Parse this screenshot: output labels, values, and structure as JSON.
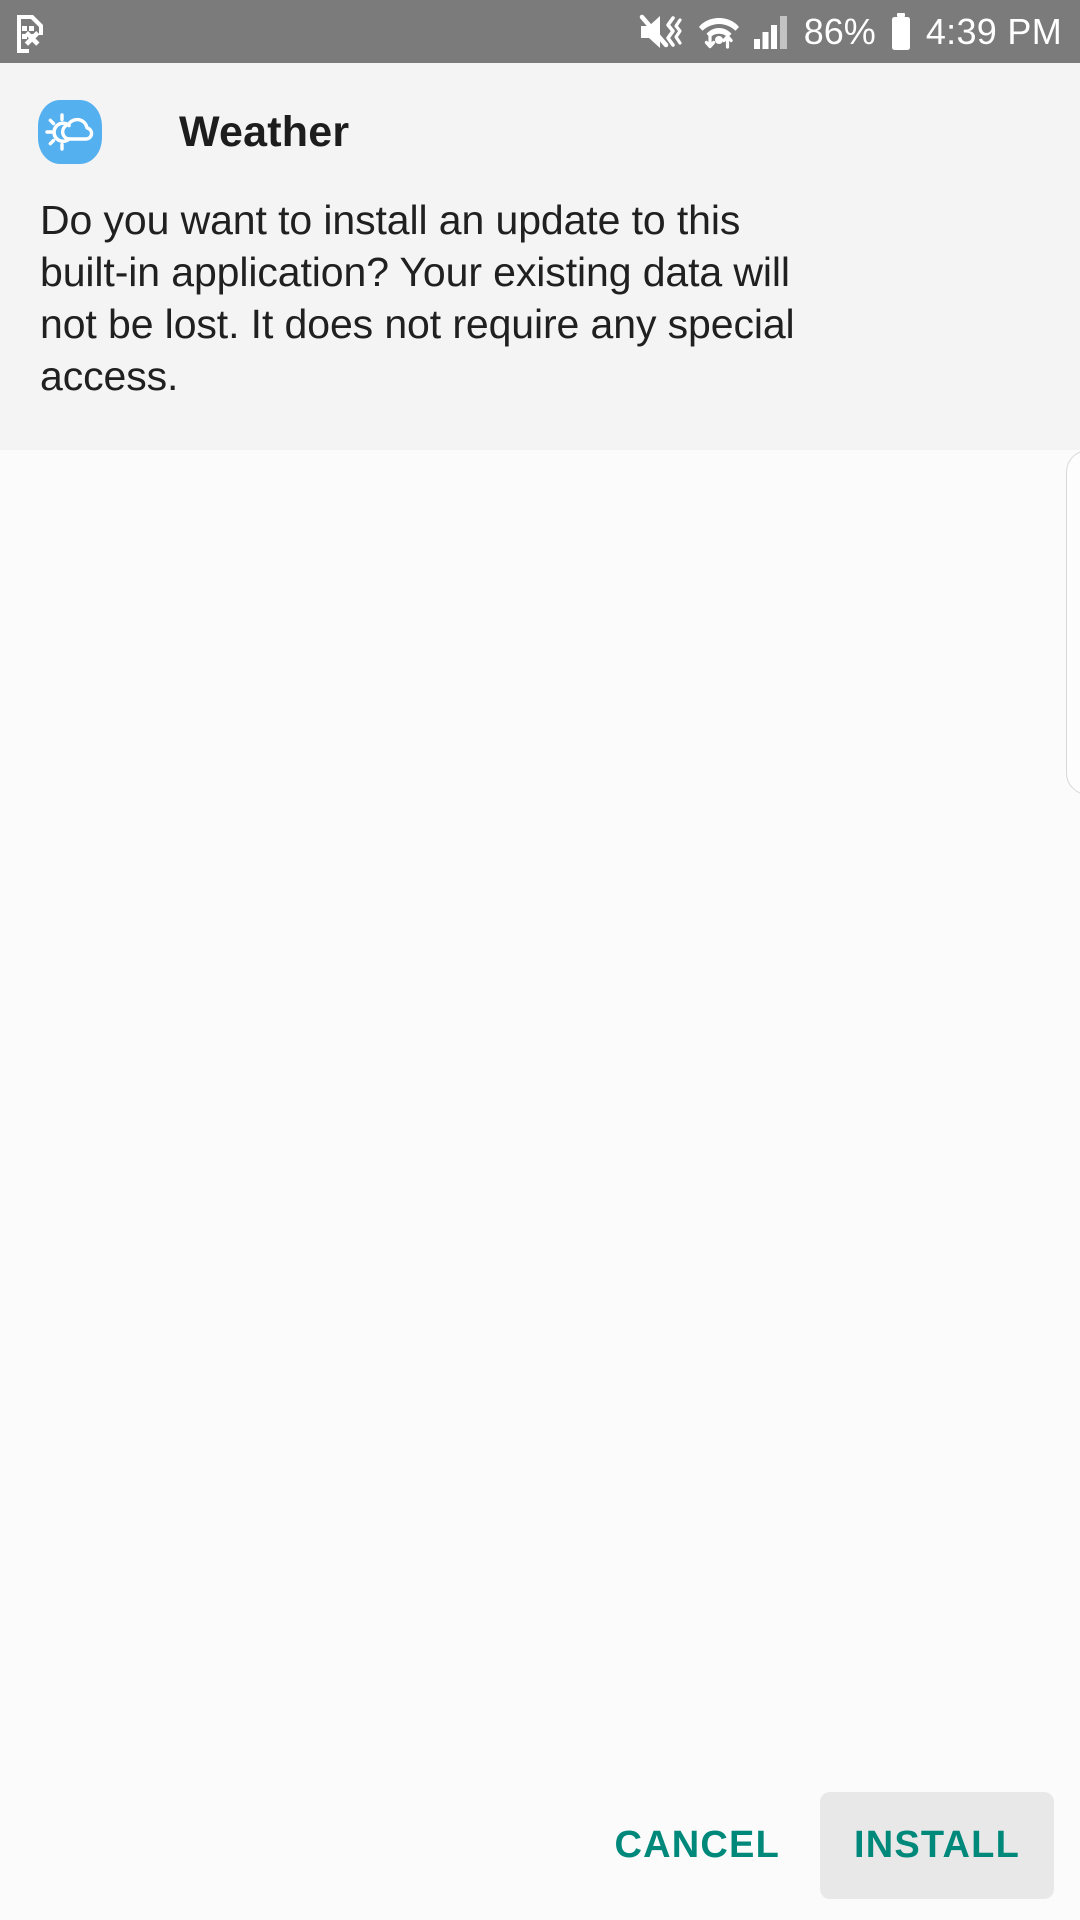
{
  "status_bar": {
    "background_color": "#7b7b7b",
    "left_icons": [
      {
        "name": "no-sim-card-icon",
        "label": "No SIM card"
      }
    ],
    "right_icons": [
      {
        "name": "mute-vibrate-icon",
        "label": "Sound off / vibrate"
      },
      {
        "name": "wifi-data-transfer-icon",
        "label": "Wi-Fi with data activity"
      },
      {
        "name": "cellular-signal-icon",
        "label": "Cellular signal"
      }
    ],
    "battery_percent": "86%",
    "battery_icon": "battery-full-icon",
    "time": "4:39 PM"
  },
  "dialog": {
    "app_icon": "weather-app-icon",
    "app_icon_color": "#55b0ef",
    "title": "Weather",
    "message": "Do you want to install an update to this built-in application? Your existing data will not be lost. It does not require any special access.",
    "background_color": "#f4f4f4"
  },
  "body": {
    "background_color": "#fbfbfb",
    "side_card": "partially-visible-card-edge"
  },
  "buttons": {
    "cancel_label": "CANCEL",
    "install_label": "INSTALL",
    "accent_color": "#00897b",
    "install_background": "#e8e8e8"
  }
}
